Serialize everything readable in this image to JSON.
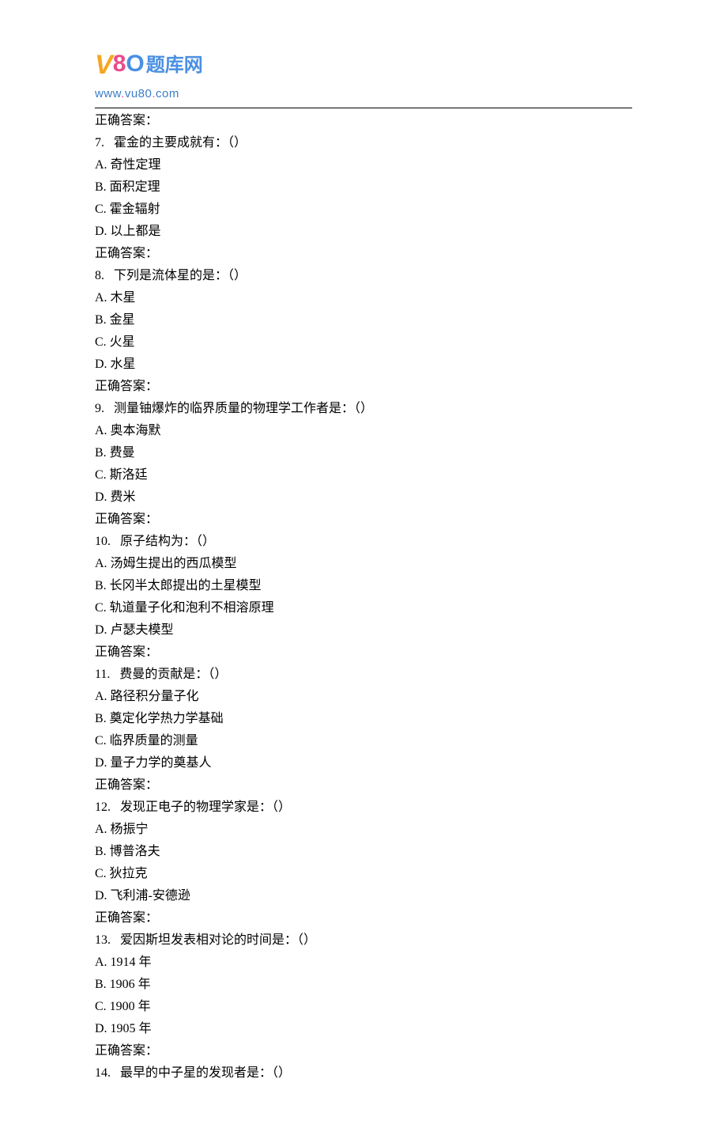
{
  "logo": {
    "bunny": "V",
    "num8": "8",
    "num0": "O",
    "chinese": "题库网",
    "url_prefix": "www",
    "url_mid1": "vu80",
    "url_mid2": "com",
    "dot": "."
  },
  "preamble": "正确答案：",
  "questions": [
    {
      "number": "7.",
      "text": "霍金的主要成就有：（）",
      "options": [
        {
          "label": "A.",
          "text": "奇性定理"
        },
        {
          "label": "B.",
          "text": "面积定理"
        },
        {
          "label": "C.",
          "text": "霍金辐射"
        },
        {
          "label": "D.",
          "text": "以上都是"
        }
      ],
      "answer_label": "正确答案："
    },
    {
      "number": "8.",
      "text": "下列是流体星的是：（）",
      "options": [
        {
          "label": "A.",
          "text": "木星"
        },
        {
          "label": "B.",
          "text": "金星"
        },
        {
          "label": "C.",
          "text": "火星"
        },
        {
          "label": "D.",
          "text": "水星"
        }
      ],
      "answer_label": "正确答案："
    },
    {
      "number": "9.",
      "text": "测量铀爆炸的临界质量的物理学工作者是：（）",
      "options": [
        {
          "label": "A.",
          "text": "奥本海默"
        },
        {
          "label": "B.",
          "text": "费曼"
        },
        {
          "label": "C.",
          "text": "斯洛廷"
        },
        {
          "label": "D.",
          "text": "费米"
        }
      ],
      "answer_label": "正确答案："
    },
    {
      "number": "10.",
      "text": "原子结构为：（）",
      "options": [
        {
          "label": "A.",
          "text": "汤姆生提出的西瓜模型"
        },
        {
          "label": "B.",
          "text": "长冈半太郎提出的土星模型"
        },
        {
          "label": "C.",
          "text": "轨道量子化和泡利不相溶原理"
        },
        {
          "label": "D.",
          "text": "卢瑟夫模型"
        }
      ],
      "answer_label": "正确答案："
    },
    {
      "number": "11.",
      "text": "费曼的贡献是：（）",
      "options": [
        {
          "label": "A.",
          "text": "路径积分量子化"
        },
        {
          "label": "B.",
          "text": "奠定化学热力学基础"
        },
        {
          "label": "C.",
          "text": "临界质量的测量"
        },
        {
          "label": "D.",
          "text": "量子力学的奠基人"
        }
      ],
      "answer_label": "正确答案："
    },
    {
      "number": "12.",
      "text": "发现正电子的物理学家是：（）",
      "options": [
        {
          "label": "A.",
          "text": "杨振宁"
        },
        {
          "label": "B.",
          "text": "博普洛夫"
        },
        {
          "label": "C.",
          "text": "狄拉克"
        },
        {
          "label": "D.",
          "text": "飞利浦-安德逊"
        }
      ],
      "answer_label": "正确答案："
    },
    {
      "number": "13.",
      "text": "爱因斯坦发表相对论的时间是：（）",
      "options": [
        {
          "label": "A.",
          "text": "1914 年"
        },
        {
          "label": "B.",
          "text": "1906 年"
        },
        {
          "label": "C.",
          "text": "1900 年"
        },
        {
          "label": "D.",
          "text": "1905 年"
        }
      ],
      "answer_label": "正确答案："
    },
    {
      "number": "14.",
      "text": "最早的中子星的发现者是：（）",
      "options": [],
      "answer_label": ""
    }
  ]
}
